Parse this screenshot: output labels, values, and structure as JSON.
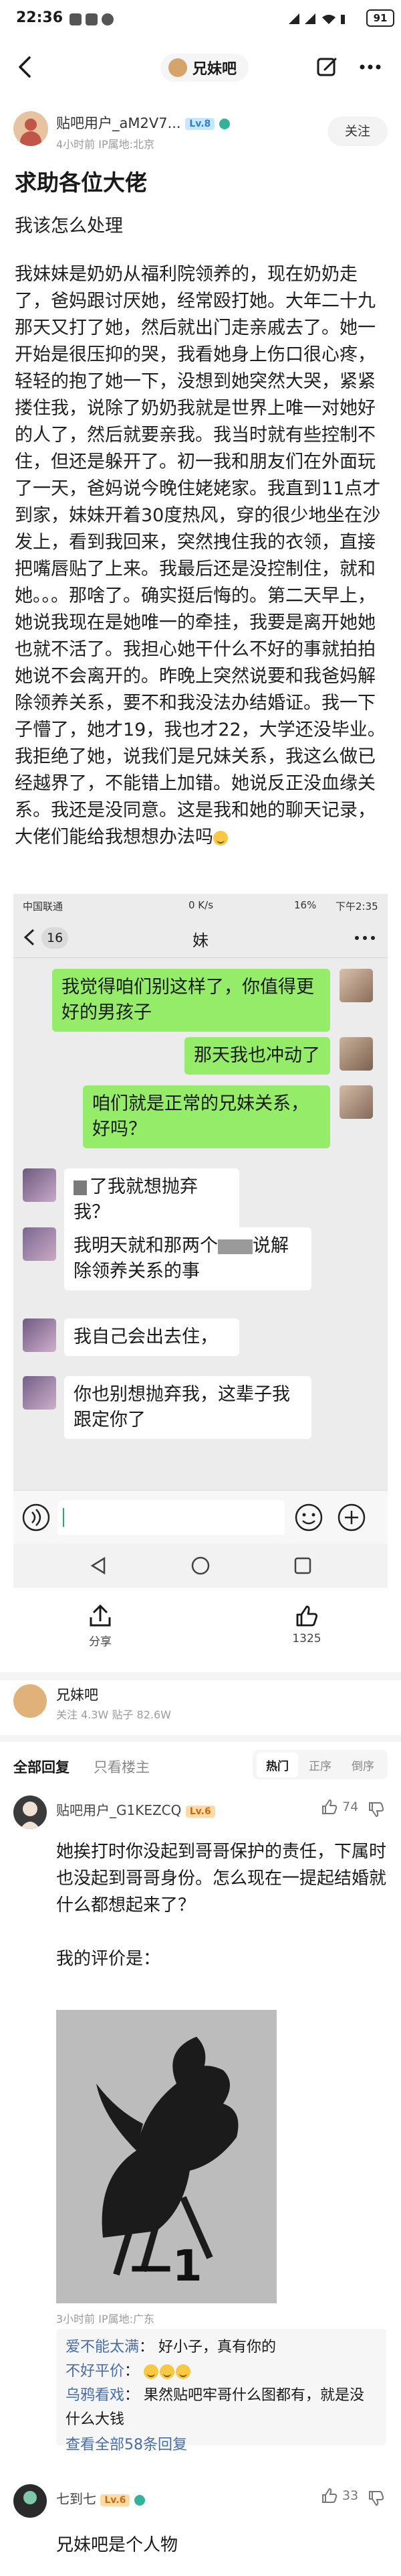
{
  "status_bar": {
    "time": "22:36",
    "battery": "91"
  },
  "nav": {
    "forum_name": "兄妹吧"
  },
  "post": {
    "author": {
      "name": "贴吧用户_aM2V7...",
      "level": "Lv.8",
      "meta": "4小时前   IP属地:北京"
    },
    "follow_label": "关注",
    "title": "求助各位大佬",
    "paragraphs": [
      "我该怎么处理",
      "我妹妹是奶奶从福利院领养的，现在奶奶走了，爸妈跟讨厌她，经常殴打她。大年二十九那天又打了她，然后就出门走亲戚去了。她一开始是很压抑的哭，我看她身上伤口很心疼，轻轻的抱了她一下，没想到她突然大哭，紧紧搂住我，说除了奶奶我就是世界上唯一对她好的人了，然后就要亲我。我当时就有些控制不住，但还是躲开了。初一我和朋友们在外面玩了一天，爸妈说今晚住姥姥家。我直到11点才到家，妹妹开着30度热风，穿的很少地坐在沙发上，看到我回来，突然拽住我的衣领，直接把嘴唇贴了上来。我最后还是没控制住，就和她。。。那啥了。确实挺后悔的。第二天早上，她说我现在是她唯一的牵挂，我要是离开她她也就不活了。我担心她干什么不好的事就拍拍她说不会离开的。昨晚上突然说要和我爸妈解除领养关系，要不和我没法办结婚证。我一下子懵了，她才19，我也才22，大学还没毕业。我拒绝了她，说我们是兄妹关系，我这么做已经越界了，不能错上加错。她说反正没血缘关系。我还是没同意。这是我和她的聊天记录，大佬们能给我想想办法吗"
    ]
  },
  "chat": {
    "status": {
      "carrier": "中国联通",
      "speed": "0 K/s",
      "battery": "16%",
      "time": "下午2:35"
    },
    "unread": "16",
    "contact": "妹",
    "messages": [
      {
        "from": "me",
        "text": "我觉得咱们别这样了，你值得更好的男孩子"
      },
      {
        "from": "me",
        "text": "那天我也冲动了"
      },
      {
        "from": "me",
        "text": "咱们就是正常的兄妹关系，好吗？"
      },
      {
        "from": "them",
        "text": "了我就想抛弃我？"
      },
      {
        "from": "them",
        "text": "我明天就和那两个",
        "text2": "说解除领养关系的事"
      },
      {
        "from": "them",
        "text": "我自己会出去住，"
      },
      {
        "from": "them",
        "text": "你也别想抛弃我，这辈子我跟定你了"
      }
    ]
  },
  "actions": {
    "share_label": "分享",
    "like_count": "1325"
  },
  "forum_card": {
    "name": "兄妹吧",
    "stats": "关注 4.3W   贴子 82.6W"
  },
  "replies": {
    "tabs": [
      "全部回复",
      "只看楼主"
    ],
    "sort_options": [
      "热门",
      "正序",
      "倒序"
    ],
    "comments": [
      {
        "author": "贴吧用户_G1KEZCQ",
        "level": "Lv.6",
        "likes": "74",
        "text": "她挨打时你没起到哥哥保护的责任，下属时也没起到哥哥身份。怎么现在一提起结婚就什么都想起来了？",
        "text2": "我的评价是：",
        "meme_caption": "—1",
        "meta": "3小时前   IP属地:广东",
        "subreplies": [
          {
            "name": "爱不能太满",
            "text": "好小子，真有你的"
          },
          {
            "name": "不好平价",
            "text": ""
          },
          {
            "name": "乌鸦看戏",
            "text": "果然贴吧牢哥什么图都有，就是没什么大钱"
          }
        ],
        "more_label": "查看全部58条回复"
      },
      {
        "author": "七到七",
        "level": "Lv.6",
        "likes": "33",
        "text": "兄妹吧是个人物"
      }
    ]
  },
  "colors": {
    "accent_blue": "#3e86e3",
    "bubble_green": "#95ec69",
    "like_red": "#e5493f"
  }
}
